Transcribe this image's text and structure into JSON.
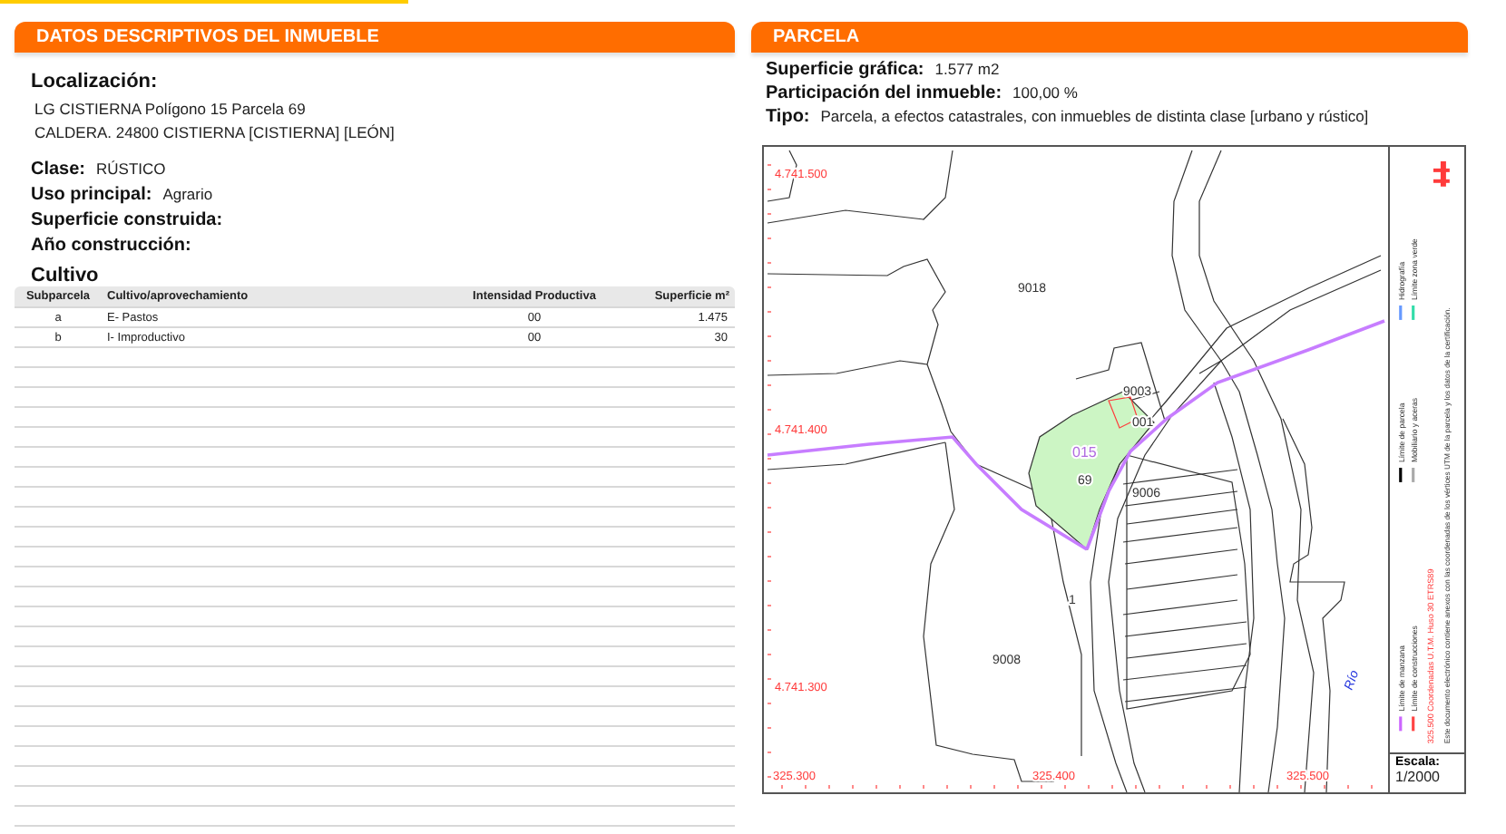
{
  "left_panel": {
    "title": "DATOS DESCRIPTIVOS DEL INMUEBLE",
    "location": {
      "label": "Localización:",
      "lines": [
        "LG CISTIERNA  Polígono 15 Parcela 69",
        "CALDERA. 24800 CISTIERNA [CISTIERNA] [LEÓN]"
      ]
    },
    "fields": [
      {
        "label": "Clase:",
        "value": "RÚSTICO"
      },
      {
        "label": "Uso principal:",
        "value": "Agrario"
      },
      {
        "label": "Superficie construida:"
      },
      {
        "label": "Año construcción:"
      }
    ],
    "crops": {
      "title": "Cultivo",
      "columns": [
        "Subparcela",
        "Cultivo/aprovechamiento",
        "Intensidad Productiva",
        "Superficie m²"
      ],
      "rows": [
        [
          "a",
          "E- Pastos",
          "00",
          "1.475"
        ],
        [
          "b",
          "I- Improductivo",
          "00",
          "30"
        ]
      ]
    }
  },
  "right_panel": {
    "title": "PARCELA",
    "fields": [
      {
        "label": "Superficie gráfica:",
        "value": "1.577 m2"
      },
      {
        "label": "Participación del inmueble:",
        "value": "100,00 %"
      },
      {
        "label": "Tipo:",
        "value": "Parcela, a efectos catastrales, con inmuebles de distinta clase [urbano y rústico]"
      }
    ],
    "map": {
      "y_coordinates": [
        "4.741.500",
        "4.741.400",
        "4.741.300"
      ],
      "x_coordinates": [
        "325.300",
        "325.400",
        "325.500"
      ],
      "parcel_labels": [
        "9018",
        "9003",
        "001",
        "015",
        "69",
        "9006",
        "9008",
        "1"
      ],
      "water_label": "Río",
      "legend": [
        {
          "text": "Límite de manzana",
          "color": "#cc66ff"
        },
        {
          "text": "Límite de construcciones",
          "color": "#ff4444"
        },
        {
          "text": "Límite de parcela",
          "color": "#000000"
        },
        {
          "text": "Mobiliario y aceras",
          "color": "#aaaaaa"
        },
        {
          "text": "Hidrografía",
          "color": "#6699ff"
        },
        {
          "text": "Límite zona verde",
          "color": "#33ddaa"
        }
      ],
      "coordinates_note": "325.500 Coordenadas U.T.M. Huso 30 ETRS89",
      "document_note": "Este documento electrónico contiene anexos con las coordenadas de los vértices UTM de la parcela y los datos de la certificación.",
      "scale_label": "Escala:",
      "scale_value": "1/2000"
    }
  }
}
